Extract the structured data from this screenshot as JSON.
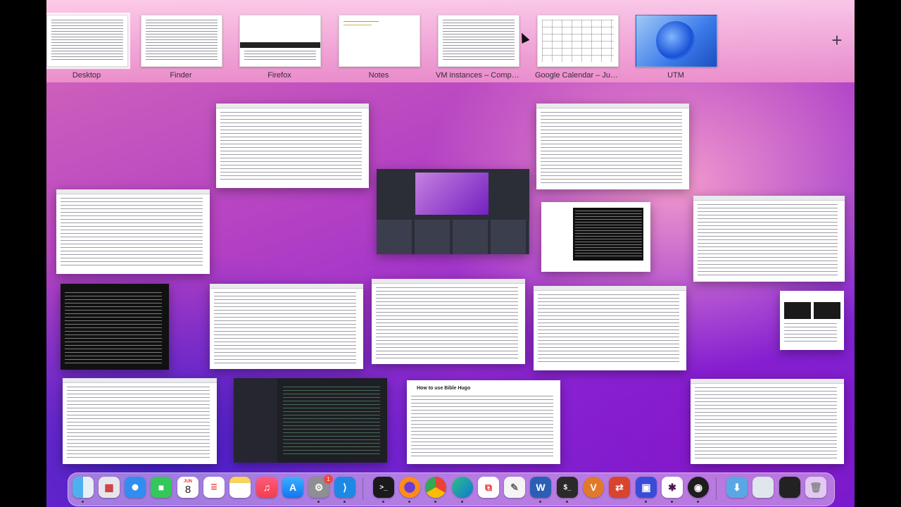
{
  "spaces": [
    {
      "label": "Desktop"
    },
    {
      "label": "Finder"
    },
    {
      "label": "Firefox"
    },
    {
      "label": "Notes"
    },
    {
      "label": "VM instances – Comput..."
    },
    {
      "label": "Google Calendar – June..."
    },
    {
      "label": "UTM"
    }
  ],
  "add_space_label": "+",
  "docs": {
    "bible_title": "How to use Bible Hugo"
  },
  "dock": {
    "calendar_month": "JUN",
    "calendar_day": "8",
    "settings_badge": "1",
    "icons": [
      "finder-icon",
      "launchpad-icon",
      "safari-icon",
      "facetime-icon",
      "calendar-icon",
      "reminders-icon",
      "notes-icon",
      "music-icon",
      "app-store-icon",
      "system-settings-icon",
      "vscode-icon",
      "terminal-icon",
      "firefox-icon",
      "chrome-icon",
      "edge-icon",
      "parallels-icon",
      "textedit-icon",
      "word-icon",
      "iterm-icon",
      "vnc-viewer-icon",
      "remote-desktop-icon",
      "utm-icon",
      "slack-icon",
      "obs-icon",
      "downloads-folder-icon",
      "stack-icon",
      "screen-stack-icon",
      "trash-icon"
    ]
  }
}
